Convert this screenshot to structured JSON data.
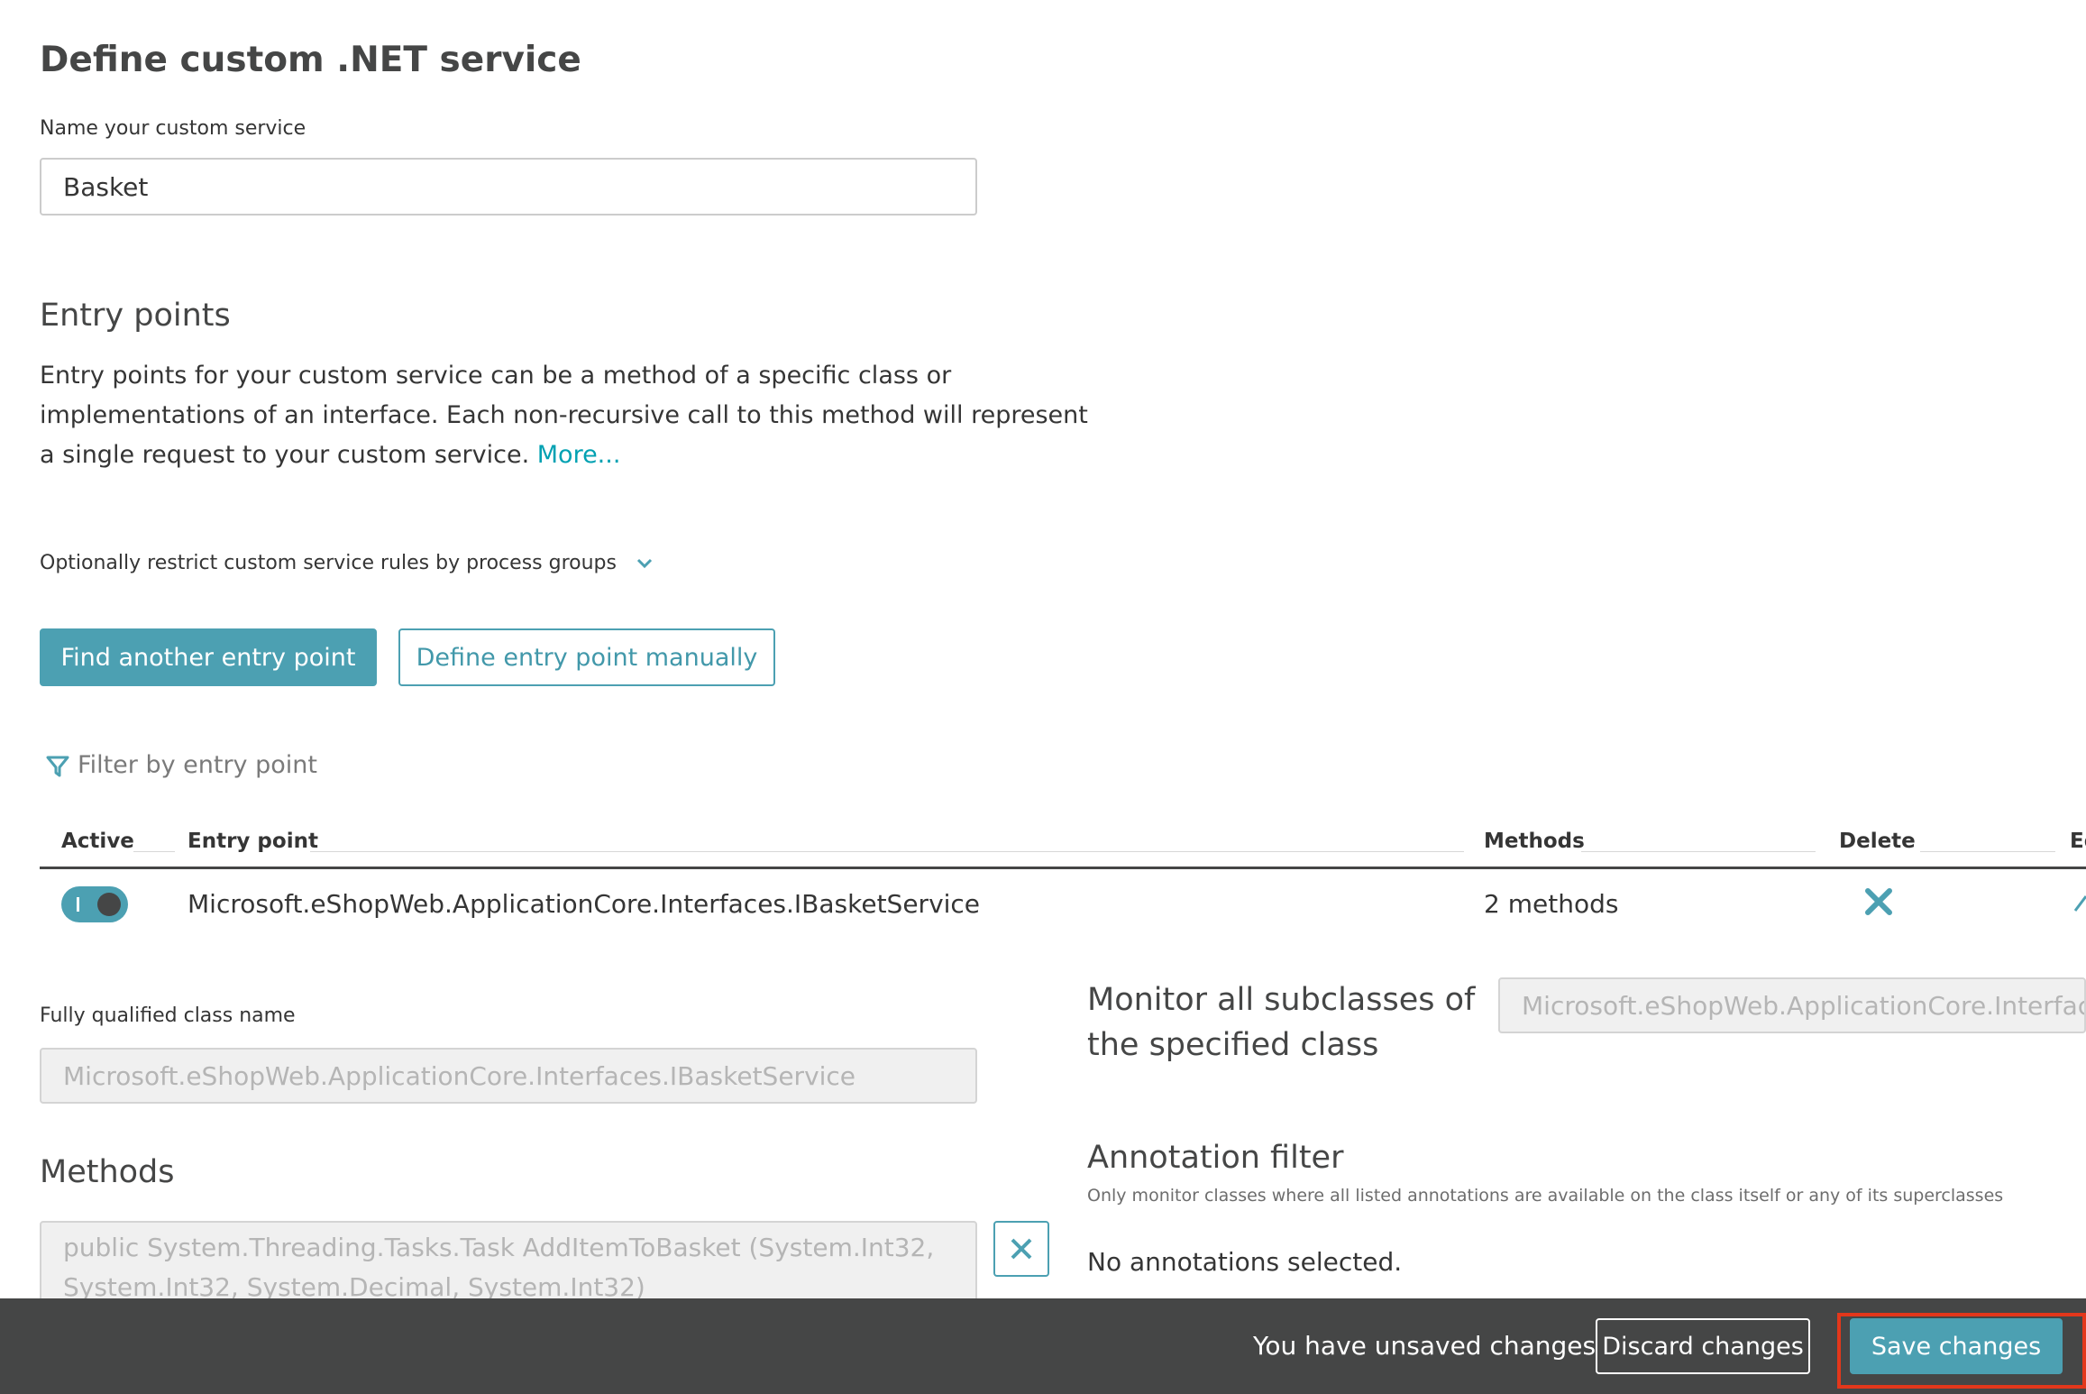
{
  "page": {
    "title": "Define custom .NET service",
    "name_label": "Name your custom service",
    "name_value": "Basket"
  },
  "entry_points": {
    "heading": "Entry points",
    "description": "Entry points for your custom service can be a method of a specific class or implementations of an interface. Each non-recursive call to this method will represent a single request to your custom service.",
    "more_link": "More...",
    "restrict_label": "Optionally restrict custom service rules by process groups",
    "find_button": "Find another entry point",
    "define_button": "Define entry point manually",
    "filter_placeholder": "Filter by entry point"
  },
  "table": {
    "headers": {
      "active": "Active",
      "entry_point": "Entry point",
      "methods": "Methods",
      "delete": "Delete",
      "edit": "Ed"
    },
    "rows": [
      {
        "entry_point": "Microsoft.eShopWeb.ApplicationCore.Interfaces.IBasketService",
        "methods": "2 methods",
        "active": true
      }
    ]
  },
  "details": {
    "class_label": "Fully qualified class name",
    "class_value": "Microsoft.eShopWeb.ApplicationCore.Interfaces.IBasketService",
    "subclass_label": "Monitor all subclasses of the specified class",
    "subclass_value": "Microsoft.eShopWeb.ApplicationCore.Interfaces.IB",
    "methods_heading": "Methods",
    "method_value": "public System.Threading.Tasks.Task AddItemToBasket (System.Int32, System.Int32, System.Decimal, System.Int32)",
    "annotation_heading": "Annotation filter",
    "annotation_note": "Only monitor classes where all listed annotations are available on the class itself or any of its superclasses",
    "annotation_empty": "No annotations selected."
  },
  "footer": {
    "unsaved_text": "You have unsaved changes.",
    "discard_button": "Discard changes",
    "save_button": "Save changes"
  },
  "colors": {
    "accent": "#4ca0b2",
    "link": "#00a1b2",
    "footer_bg": "#454646",
    "highlight": "#e3371b"
  },
  "icons": {
    "restrict_chevron": "chevron-down-icon",
    "filter": "filter-icon",
    "delete": "close-icon",
    "edit": "pencil-icon",
    "remove_method": "close-icon"
  }
}
